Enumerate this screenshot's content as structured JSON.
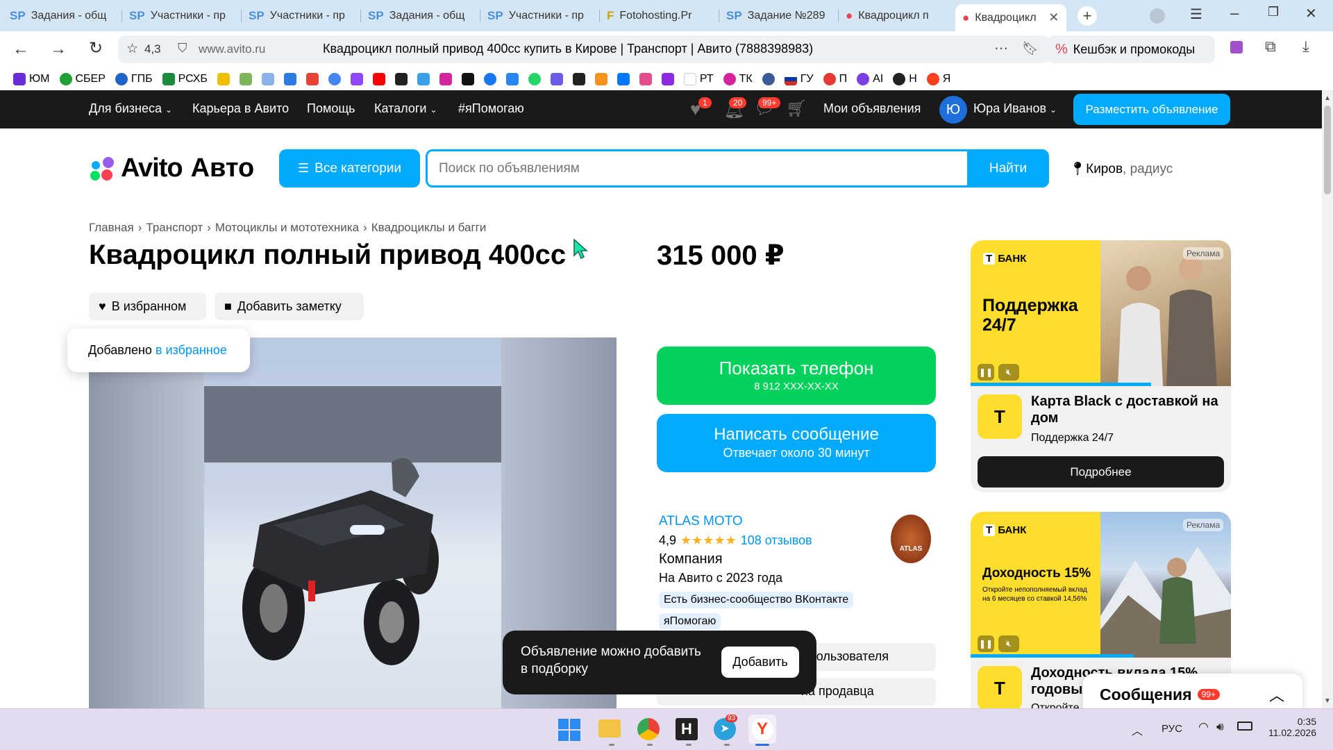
{
  "browser": {
    "tabs": [
      {
        "icon": "SP",
        "title": "Задания - общ"
      },
      {
        "icon": "SP",
        "title": "Участники - пр"
      },
      {
        "icon": "SP",
        "title": "Участники - пр"
      },
      {
        "icon": "SP",
        "title": "Задания - общ"
      },
      {
        "icon": "SP",
        "title": "Участники - пр"
      },
      {
        "icon": "F",
        "title": "Fotohosting.Pr"
      },
      {
        "icon": "SP",
        "title": "Задание №289"
      },
      {
        "icon": "●",
        "title": "Квадроцикл п"
      },
      {
        "icon": "●",
        "title": "Квадроцикл"
      }
    ],
    "rating": "4,3",
    "domain": "www.avito.ru",
    "page_title": "Квадроцикл полный привод 400сс купить в Кирове | Транспорт | Авито (7888398983)",
    "cashback": "Кешбэк и промокоды",
    "bookmarks": [
      "ЮМ",
      "СБЕР",
      "ГПБ",
      "РСХБ",
      "",
      "",
      "",
      "",
      "",
      "",
      "",
      "",
      "",
      "",
      "",
      "",
      "",
      "",
      "",
      "",
      "",
      "",
      "",
      "",
      "",
      "РТ",
      "ТК",
      "",
      "ГУ",
      "П",
      "AI",
      "Н",
      "Я"
    ]
  },
  "avito_header": {
    "business": "Для бизнеса",
    "career": "Карьера в Авито",
    "help": "Помощь",
    "catalogs": "Каталоги",
    "ihelp": "#яПомогаю",
    "fav_count": "1",
    "notif_count": "20",
    "msg_count": "99+",
    "my_ads": "Мои объявления",
    "avatar_letter": "Ю",
    "user_name": "Юра Иванов",
    "post_ad": "Разместить объявление"
  },
  "search": {
    "logo_avito": "Avito",
    "logo_auto": "Авто",
    "categories": "Все категории",
    "placeholder": "Поиск по объявлениям",
    "find": "Найти",
    "city": "Киров",
    "radius": ", радиус"
  },
  "breadcrumbs": [
    "Главная",
    "Транспорт",
    "Мотоциклы и мототехника",
    "Квадроциклы и багги"
  ],
  "listing": {
    "title": "Квадроцикл полный привод 400сс",
    "price": "315 000 ₽",
    "in_favorites": "В избранном",
    "add_note": "Добавить заметку",
    "toast_text": "Добавлено ",
    "toast_link": "в избранное",
    "show_phone": "Показать телефон",
    "phone_masked": "8 912 XXX-XX-XX",
    "write_message": "Написать сообщение",
    "reply_time": "Отвечает около 30 минут"
  },
  "seller": {
    "name": "ATLAS MOTO",
    "rating": "4,9",
    "stars": "★★★★★",
    "reviews": "108 отзывов",
    "type": "Компания",
    "since": "На Авито с 2023 года",
    "badge1": "Есть бизнес-сообщество ВКонтакте",
    "badge2": "яПомогаю",
    "row1": "пользователя",
    "row2": "на продавца",
    "logo_text": "ATLAS"
  },
  "popup": {
    "text": "Объявление можно добавить в подборку",
    "button": "Добавить"
  },
  "ads": [
    {
      "bank": "БАНК",
      "ad_label": "Реклама",
      "headline": "Поддержка 24/7",
      "title": "Карта Black с доставкой на дом",
      "subtitle": "Поддержка 24/7",
      "button": "Подробнее"
    },
    {
      "bank": "БАНК",
      "ad_label": "Реклама",
      "headline": "Доходность 15%",
      "small": "Откройте непополняемый вклад на 6 месяцев со ставкой 14,56%",
      "title": "Доходность вклада 15% годовых",
      "subtitle": "Откройте"
    }
  ],
  "messages_widget": {
    "label": "Сообщения",
    "count": "99+"
  },
  "taskbar": {
    "lang": "РУС",
    "time": "0:35",
    "date": "11.02.2026",
    "telegram_badge": "93"
  }
}
